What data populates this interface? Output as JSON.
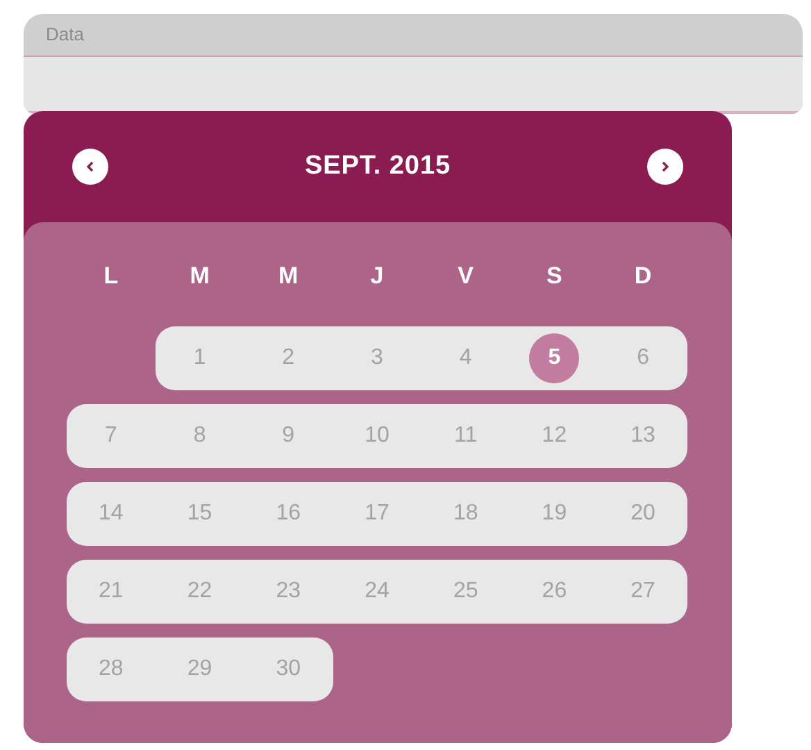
{
  "field": {
    "label": "Data"
  },
  "calendar": {
    "title": "SEPT. 2015",
    "weekdays": [
      "L",
      "M",
      "M",
      "J",
      "V",
      "S",
      "D"
    ],
    "weeks": [
      [
        {
          "label": "1",
          "selected": false
        },
        {
          "label": "2",
          "selected": false
        },
        {
          "label": "3",
          "selected": false
        },
        {
          "label": "4",
          "selected": false
        },
        {
          "label": "5",
          "selected": true
        },
        {
          "label": "6",
          "selected": false
        }
      ],
      [
        {
          "label": "7",
          "selected": false
        },
        {
          "label": "8",
          "selected": false
        },
        {
          "label": "9",
          "selected": false
        },
        {
          "label": "10",
          "selected": false
        },
        {
          "label": "11",
          "selected": false
        },
        {
          "label": "12",
          "selected": false
        },
        {
          "label": "13",
          "selected": false
        }
      ],
      [
        {
          "label": "14",
          "selected": false
        },
        {
          "label": "15",
          "selected": false
        },
        {
          "label": "16",
          "selected": false
        },
        {
          "label": "17",
          "selected": false
        },
        {
          "label": "18",
          "selected": false
        },
        {
          "label": "19",
          "selected": false
        },
        {
          "label": "20",
          "selected": false
        }
      ],
      [
        {
          "label": "21",
          "selected": false
        },
        {
          "label": "22",
          "selected": false
        },
        {
          "label": "23",
          "selected": false
        },
        {
          "label": "24",
          "selected": false
        },
        {
          "label": "25",
          "selected": false
        },
        {
          "label": "26",
          "selected": false
        },
        {
          "label": "27",
          "selected": false
        }
      ],
      [
        {
          "label": "28",
          "selected": false
        },
        {
          "label": "29",
          "selected": false
        },
        {
          "label": "30",
          "selected": false
        }
      ]
    ]
  }
}
